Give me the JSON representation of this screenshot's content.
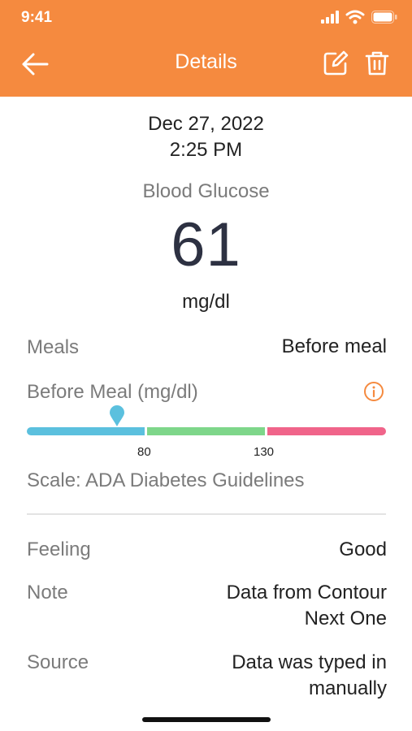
{
  "status_bar": {
    "time": "9:41"
  },
  "header": {
    "title": "Details"
  },
  "reading": {
    "date": "Dec 27, 2022",
    "time": "2:25 PM",
    "metric": "Blood Glucose",
    "value": "61",
    "unit": "mg/dl"
  },
  "meals": {
    "label": "Meals",
    "value": "Before meal"
  },
  "range": {
    "label": "Before Meal (mg/dl)",
    "ticks": [
      "80",
      "130"
    ],
    "scale": "Scale: ADA Diabetes Guidelines",
    "colors": {
      "low": "#5BC0DE",
      "normal": "#7ED68A",
      "high": "#F0648A"
    }
  },
  "details": [
    {
      "label": "Feeling",
      "value": "Good"
    },
    {
      "label": "Note",
      "value_lines": [
        "Data from Contour",
        "Next One"
      ]
    },
    {
      "label": "Source",
      "value_lines": [
        "Data was typed in",
        "manually"
      ]
    }
  ],
  "colors": {
    "accent": "#F58A3F"
  },
  "icons": [
    "back-arrow-icon",
    "edit-icon",
    "trash-icon",
    "info-icon",
    "signal-icon",
    "wifi-icon",
    "battery-icon"
  ]
}
